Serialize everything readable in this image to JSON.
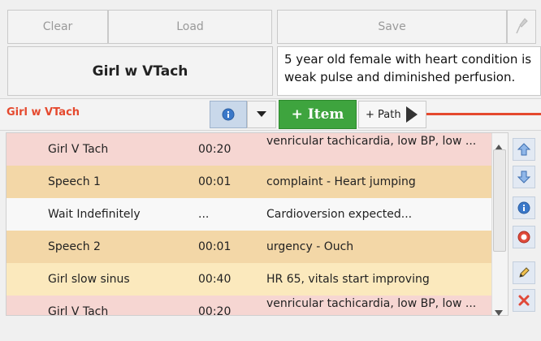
{
  "toolbar": {
    "clear_label": "Clear",
    "load_label": "Load",
    "save_label": "Save",
    "pin_icon": "pin-icon"
  },
  "scenario": {
    "title": "Girl w VTach",
    "description_line1": "5 year old female with heart condition is",
    "description_line2": "weak pulse and diminished perfusion."
  },
  "pathbar": {
    "path_name": "Girl w VTach",
    "info_icon": "info-icon",
    "dropdown_icon": "chevron-down-icon",
    "add_item_label": "+ Item",
    "add_path_label": "+ Path",
    "path_arrow_icon": "play-arrow-icon"
  },
  "items": [
    {
      "name": "Girl V Tach",
      "time": "00:20",
      "note": "venricular tachicardia, low BP, low ...",
      "color": "#f6d6d2"
    },
    {
      "name": "Speech 1",
      "time": "00:01",
      "note": "complaint - Heart jumping",
      "color": "#f3d7a7"
    },
    {
      "name": "Wait Indefinitely",
      "time": "...",
      "note": "Cardioversion expected...",
      "color": "#f8f8f8"
    },
    {
      "name": "Speech 2",
      "time": "00:01",
      "note": "urgency - Ouch",
      "color": "#f3d7a7"
    },
    {
      "name": "Girl slow sinus",
      "time": "00:40",
      "note": "HR 65, vitals start improving",
      "color": "#fbe9bd"
    },
    {
      "name": "Girl V Tach",
      "time": "00:20",
      "note": "venricular tachicardia, low BP, low ...",
      "color": "#f6d6d2"
    }
  ],
  "current_item_index": 2,
  "side_buttons": [
    "move-up-icon",
    "move-down-icon",
    "info-icon",
    "stop-icon",
    "edit-icon",
    "delete-icon"
  ],
  "colors": {
    "accent_green": "#3ea43e",
    "path_red": "#e5492e",
    "play_green": "#2e8b2e"
  }
}
